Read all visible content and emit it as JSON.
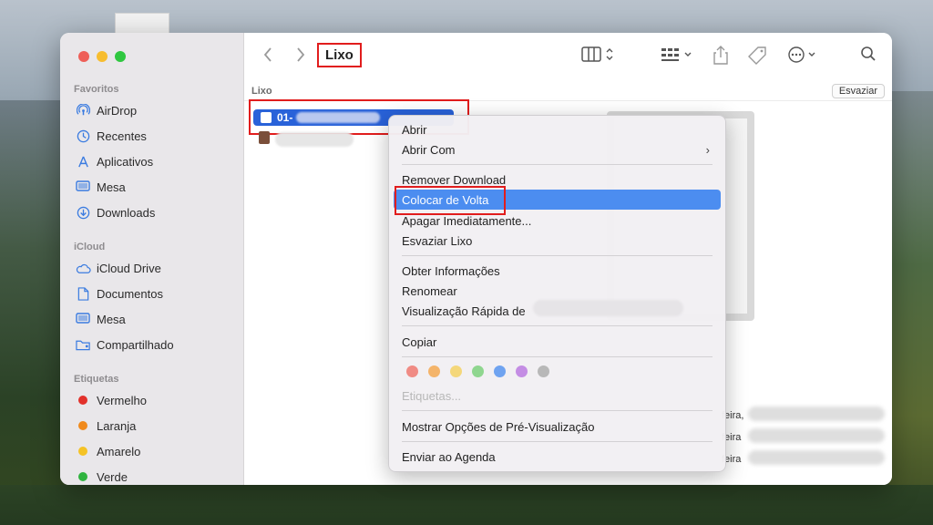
{
  "sidebar": {
    "sections": [
      {
        "title": "Favoritos",
        "items": [
          {
            "label": "AirDrop",
            "icon": "airdrop-icon"
          },
          {
            "label": "Recentes",
            "icon": "clock-icon"
          },
          {
            "label": "Aplicativos",
            "icon": "applications-icon"
          },
          {
            "label": "Mesa",
            "icon": "desktop-icon"
          },
          {
            "label": "Downloads",
            "icon": "download-icon"
          }
        ]
      },
      {
        "title": "iCloud",
        "items": [
          {
            "label": "iCloud Drive",
            "icon": "cloud-icon"
          },
          {
            "label": "Documentos",
            "icon": "document-icon"
          },
          {
            "label": "Mesa",
            "icon": "desktop-icon"
          },
          {
            "label": "Compartilhado",
            "icon": "shared-folder-icon"
          }
        ]
      },
      {
        "title": "Etiquetas",
        "items": [
          {
            "label": "Vermelho",
            "color": "#e2312b"
          },
          {
            "label": "Laranja",
            "color": "#f08a1c"
          },
          {
            "label": "Amarelo",
            "color": "#f5c326"
          },
          {
            "label": "Verde",
            "color": "#2fb33f"
          }
        ]
      }
    ]
  },
  "toolbar": {
    "title": "Lixo"
  },
  "pathbar": {
    "label": "Lixo",
    "empty_button": "Esvaziar"
  },
  "file": {
    "name_visible": "01-"
  },
  "right_rows": [
    "feira,",
    "feira",
    "feira"
  ],
  "context_menu": {
    "items": [
      {
        "label": "Abrir"
      },
      {
        "label": "Abrir Com",
        "submenu": true
      },
      {
        "label": "Remover Download"
      },
      {
        "label": "Colocar de Volta",
        "active": true
      },
      {
        "label": "Apagar Imediatamente..."
      },
      {
        "label": "Esvaziar Lixo"
      },
      {
        "label": "Obter Informações"
      },
      {
        "label": "Renomear"
      },
      {
        "label": "Visualização Rápida de"
      },
      {
        "label": "Copiar"
      },
      {
        "label": "Etiquetas...",
        "disabled": true
      },
      {
        "label": "Mostrar Opções de Pré-Visualização"
      },
      {
        "label": "Enviar ao Agenda"
      }
    ],
    "tag_colors": [
      "#f08b84",
      "#f4b46a",
      "#f4d77a",
      "#8fd68f",
      "#6fa3f0",
      "#c48de4",
      "#b8b8b8"
    ],
    "accent": "#4c8df0"
  }
}
